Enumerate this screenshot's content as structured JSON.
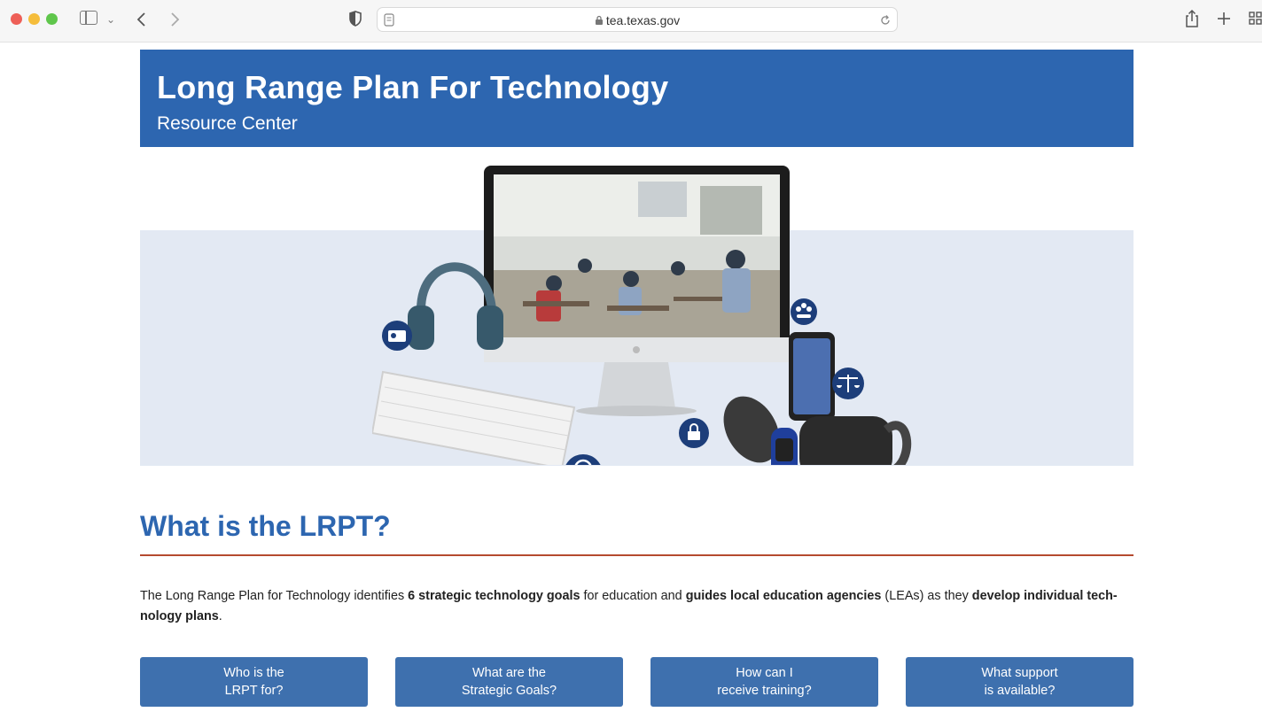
{
  "browser": {
    "url": "tea.texas.gov",
    "icons": [
      "close-dot",
      "minimize-dot",
      "zoom-dot",
      "sidebar-icon",
      "chevron-down-icon",
      "back-arrow-icon",
      "forward-arrow-icon",
      "shield-icon",
      "page-icon",
      "lock-icon",
      "reload-icon",
      "share-icon",
      "plus-icon",
      "tabs-grid-icon"
    ]
  },
  "header": {
    "title": "Long Range Plan For Technology",
    "subtitle": "Resource Center"
  },
  "section": {
    "title": "What is the LRPT?",
    "intro": {
      "p1": "The Long Range Plan for Technology identifies ",
      "b1": "6 strategic technology goals",
      "p2": " for education and ",
      "b2": "guides local education agencies",
      "p3": " (LEAs) as they ",
      "b3": "develop individual tech-nology plans",
      "p4": "."
    }
  },
  "buttons": [
    {
      "label": "Who is the\nLRPT for?"
    },
    {
      "label": "What are the\nStrategic Goals?"
    },
    {
      "label": "How can I\nreceive training?"
    },
    {
      "label": "What support\nis available?"
    }
  ],
  "colors": {
    "brand_blue": "#2d66b0",
    "button_blue": "#3e70ae",
    "rule_red": "#b54a2f",
    "band_bg": "#e3e9f3"
  }
}
